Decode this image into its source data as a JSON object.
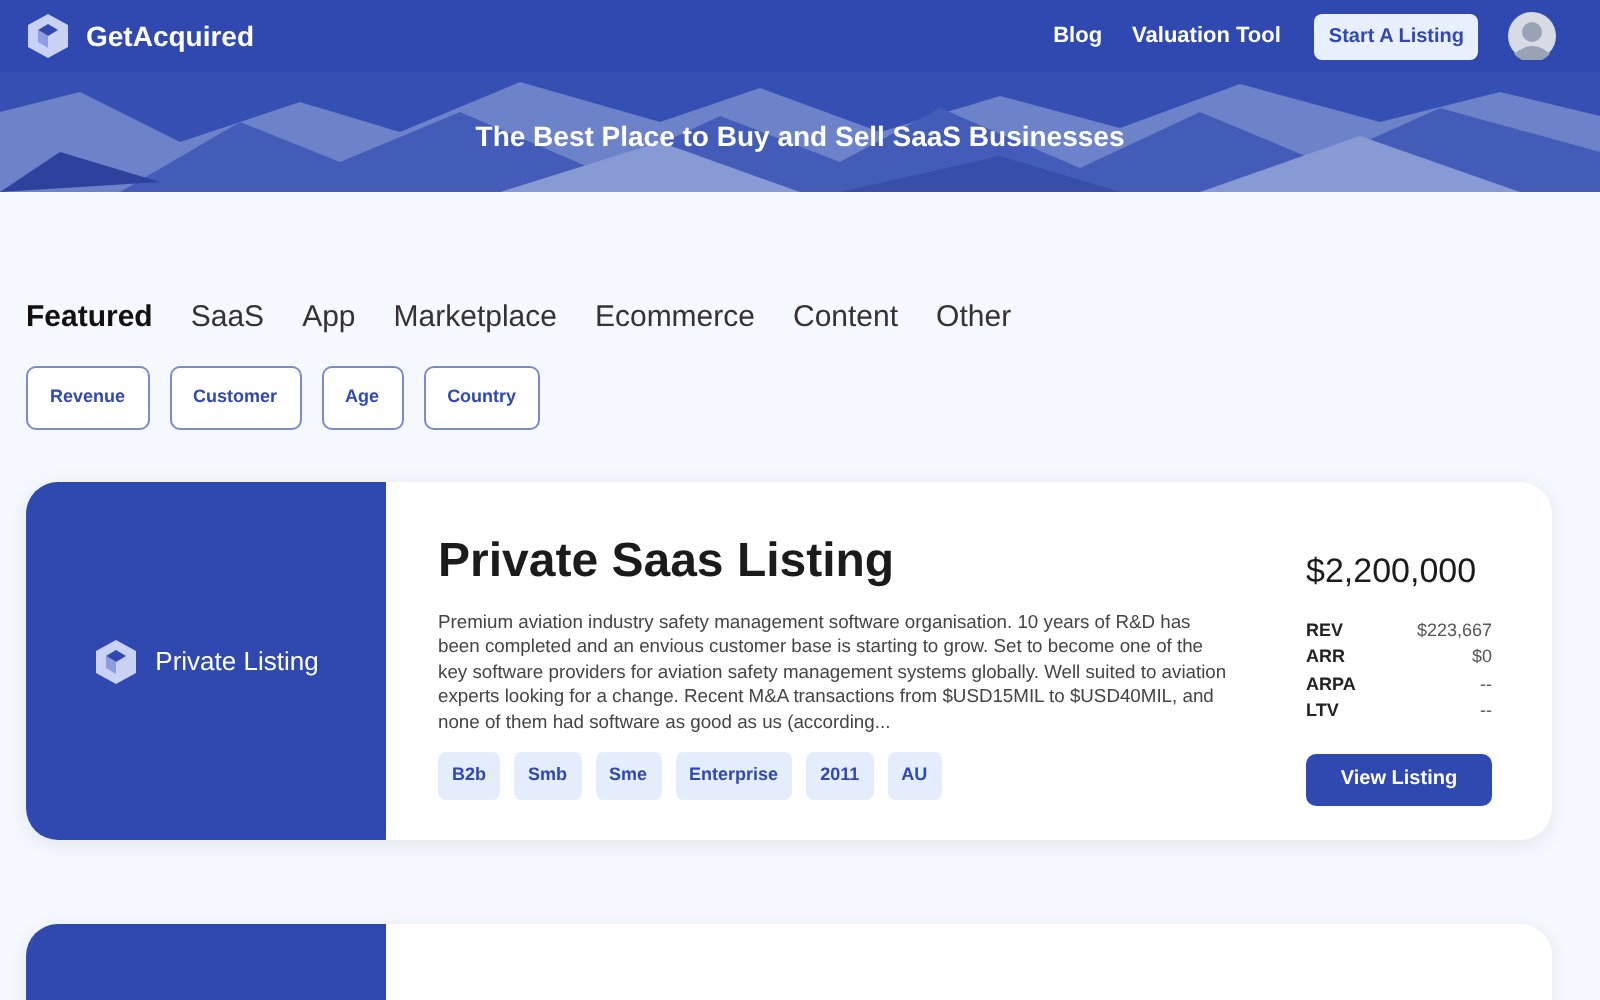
{
  "header": {
    "brand": "GetAcquired",
    "nav": [
      "Blog",
      "Valuation Tool"
    ],
    "cta": "Start A Listing"
  },
  "hero": {
    "title": "The Best Place to Buy and Sell SaaS Businesses",
    "kind": "picture"
  },
  "tabs": [
    {
      "label": "Featured",
      "selected": true
    },
    {
      "label": "SaaS",
      "selected": false
    },
    {
      "label": "App",
      "selected": false
    },
    {
      "label": "Marketplace",
      "selected": false
    },
    {
      "label": "Ecommerce",
      "selected": false
    },
    {
      "label": "Content",
      "selected": false
    },
    {
      "label": "Other",
      "selected": false
    }
  ],
  "filters": [
    "Revenue",
    "Customer",
    "Age",
    "Country"
  ],
  "listings": [
    {
      "badge": "Private Listing",
      "title": "Private Saas Listing",
      "description": "Premium aviation industry safety management software organisation. 10 years of R&D has been completed and an envious customer base is starting to grow. Set to become one of the key software providers for aviation safety management systems globally. Well suited to aviation experts looking for a change. Recent M&A transactions from $USD15MIL to $USD40MIL, and none of them had software as good as us (according...",
      "tags": [
        "B2b",
        "Smb",
        "Sme",
        "Enterprise",
        "2011",
        "AU"
      ],
      "price": "$2,200,000",
      "metrics": [
        {
          "label": "REV",
          "value": "$223,667"
        },
        {
          "label": "ARR",
          "value": "$0"
        },
        {
          "label": "ARPA",
          "value": "--"
        },
        {
          "label": "LTV",
          "value": "--"
        }
      ],
      "button": "View Listing"
    }
  ]
}
